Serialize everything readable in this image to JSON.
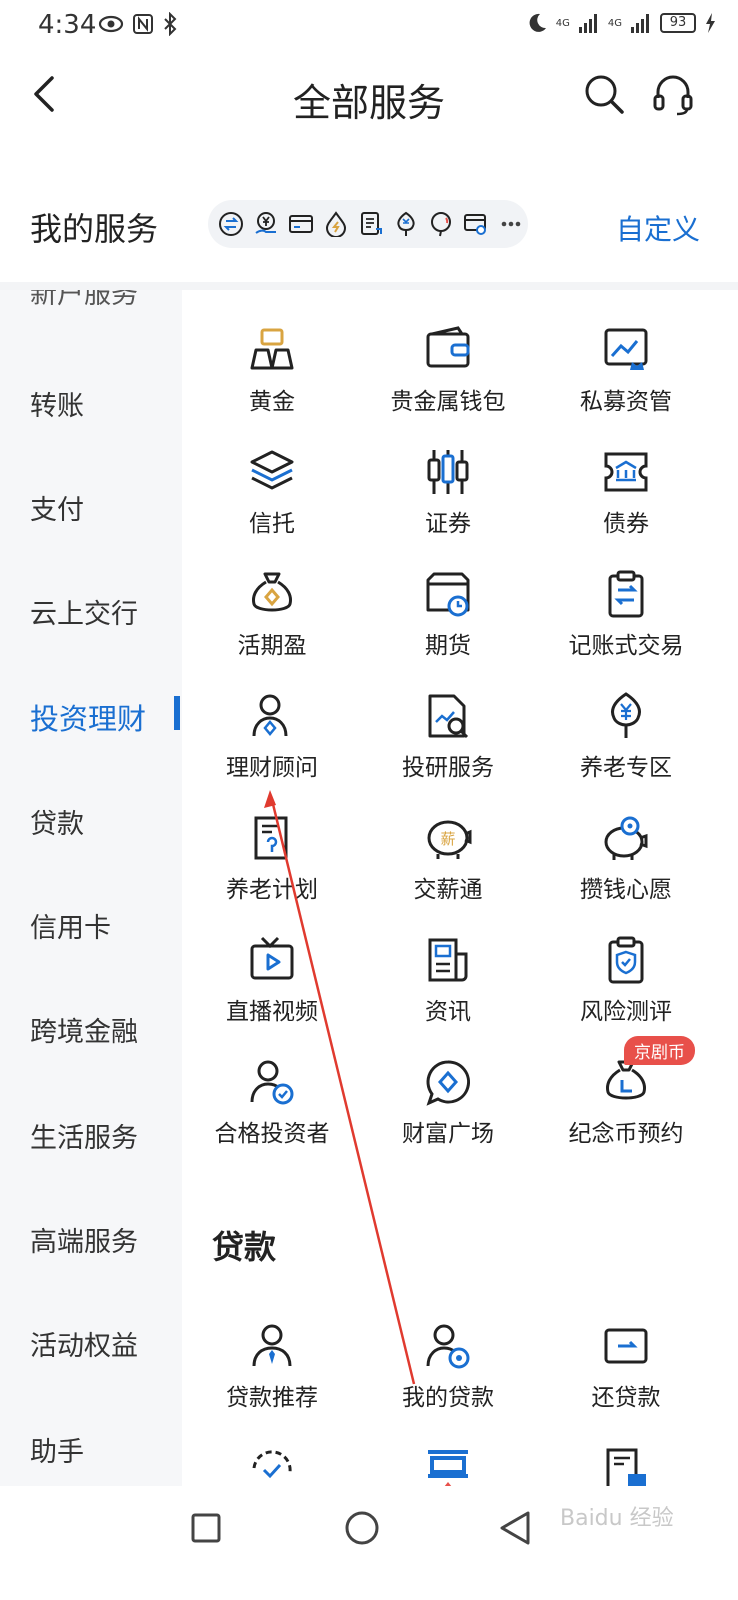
{
  "status": {
    "time": "4:34",
    "battery": "93",
    "network_a": "4G",
    "network_b": "4G"
  },
  "header": {
    "title": "全部服务"
  },
  "my_services": {
    "title": "我的服务",
    "customize": "自定义",
    "quick_icons": [
      "exchange-icon",
      "yuan-hand-icon",
      "card-icon",
      "water-drop-icon",
      "document-icon",
      "money-tree-icon",
      "balloon-icon",
      "card-link-icon",
      "more-icon"
    ]
  },
  "sidebar": {
    "items": [
      {
        "label": "转账"
      },
      {
        "label": "支付"
      },
      {
        "label": "云上交行"
      },
      {
        "label": "投资理财"
      },
      {
        "label": "贷款"
      },
      {
        "label": "信用卡"
      },
      {
        "label": "跨境金融"
      },
      {
        "label": "生活服务"
      },
      {
        "label": "高端服务"
      },
      {
        "label": "活动权益"
      },
      {
        "label": "助手"
      }
    ],
    "active_index": 3
  },
  "investment": {
    "tiles": [
      {
        "label": "黄金",
        "icon": "gold-bars-icon"
      },
      {
        "label": "贵金属钱包",
        "icon": "wallet-icon"
      },
      {
        "label": "私募资管",
        "icon": "chart-crown-icon"
      },
      {
        "label": "信托",
        "icon": "layers-icon"
      },
      {
        "label": "证券",
        "icon": "candlestick-icon"
      },
      {
        "label": "债券",
        "icon": "bank-ticket-icon"
      },
      {
        "label": "活期盈",
        "icon": "money-bag-icon"
      },
      {
        "label": "期货",
        "icon": "box-clock-icon"
      },
      {
        "label": "记账式交易",
        "icon": "clipboard-exchange-icon"
      },
      {
        "label": "理财顾问",
        "icon": "advisor-icon"
      },
      {
        "label": "投研服务",
        "icon": "research-icon"
      },
      {
        "label": "养老专区",
        "icon": "pension-tree-icon"
      },
      {
        "label": "养老计划",
        "icon": "plan-doc-icon"
      },
      {
        "label": "交薪通",
        "icon": "salary-piggy-icon"
      },
      {
        "label": "攒钱心愿",
        "icon": "savings-piggy-icon"
      },
      {
        "label": "直播视频",
        "icon": "tv-play-icon"
      },
      {
        "label": "资讯",
        "icon": "news-icon"
      },
      {
        "label": "风险测评",
        "icon": "shield-clipboard-icon"
      },
      {
        "label": "合格投资者",
        "icon": "verified-investor-icon"
      },
      {
        "label": "财富广场",
        "icon": "wealth-bubble-icon"
      },
      {
        "label": "纪念币预约",
        "icon": "coin-bag-icon"
      }
    ],
    "badge": "京剧币"
  },
  "loans": {
    "title": "贷款",
    "tiles": [
      {
        "label": "贷款推荐",
        "icon": "loan-person-icon"
      },
      {
        "label": "我的贷款",
        "icon": "my-loan-icon"
      },
      {
        "label": "还贷款",
        "icon": "repay-icon"
      }
    ]
  },
  "watermark": "Baidu 经验",
  "colors": {
    "accent": "#1a6fd1",
    "badge": "#e8504a",
    "gold": "#d9a441",
    "arrow": "#e03a2f"
  }
}
